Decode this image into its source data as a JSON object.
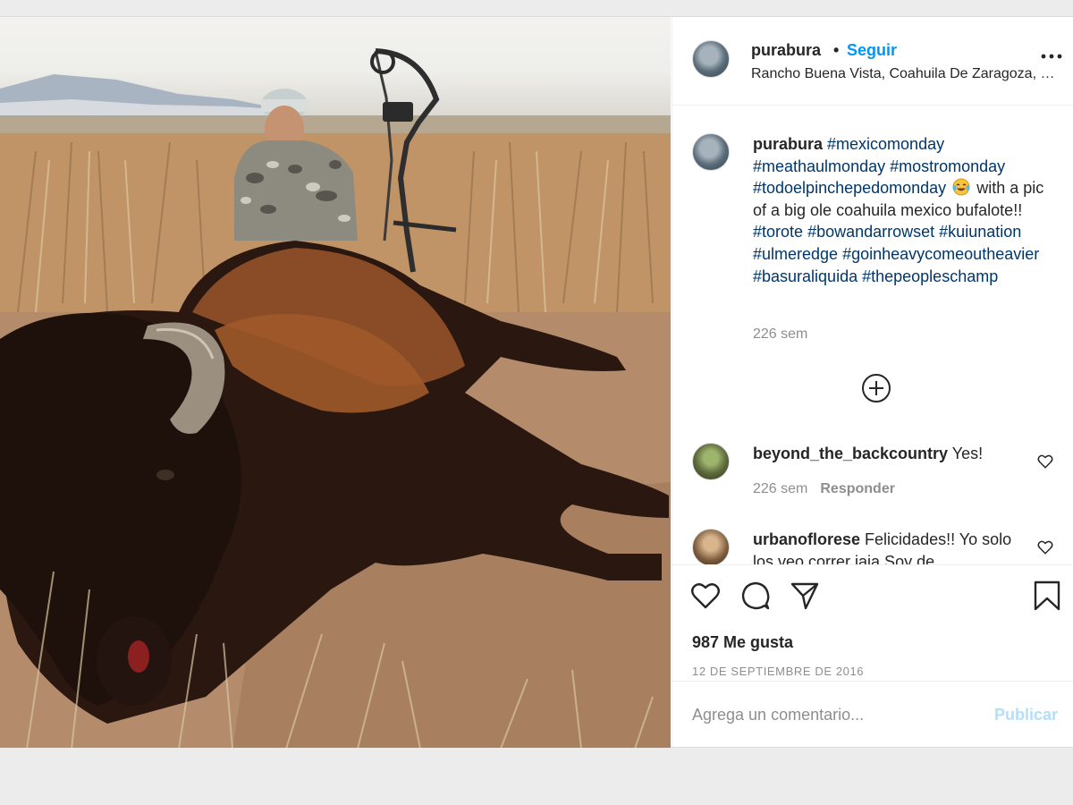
{
  "post": {
    "photo_alt": "",
    "author": {
      "username": "purabura",
      "separator": "•",
      "follow_label": "Seguir",
      "location": "Rancho Buena Vista, Coahuila De Zaragoza, Mexico"
    },
    "caption": {
      "username": "purabura",
      "parts": {
        "t1": "#mexicomonday",
        "t2": "#meathaulmonday",
        "t3": "#mostromonday",
        "t4": "#todoelpinchepedomonday",
        "text1": "with a pic of a big ole coahuila mexico bufalote!!",
        "t5": "#torote",
        "t6": "#bowandarrowset",
        "t7": "#kuiunation",
        "t8": "#ulmeredge",
        "t9": "#goinheavycomeoutheavier",
        "t10": "#basuraliquida",
        "t11": "#thepeopleschamp"
      },
      "time": "226 sem"
    },
    "comments": [
      {
        "username": "beyond_the_backcountry",
        "text": "Yes!",
        "time": "226 sem",
        "reply_label": "Responder"
      },
      {
        "username": "urbanoflorese",
        "text": "Felicidades!! Yo solo los veo correr jaja Soy de"
      }
    ],
    "likes_label": "987 Me gusta",
    "date_label": "12 DE SEPTIEMBRE DE 2016",
    "add_comment": {
      "placeholder": "Agrega un comentario...",
      "post_label": "Publicar"
    },
    "colors": {
      "link_blue": "#0095f6",
      "hashtag": "#00376b",
      "muted": "#8e8e8e",
      "publish_disabled": "#b2dffc"
    },
    "icons": [
      "more-options-icon",
      "load-more-icon",
      "heart-icon",
      "comment-icon",
      "share-icon",
      "bookmark-icon",
      "tears-of-joy-emoji"
    ]
  }
}
